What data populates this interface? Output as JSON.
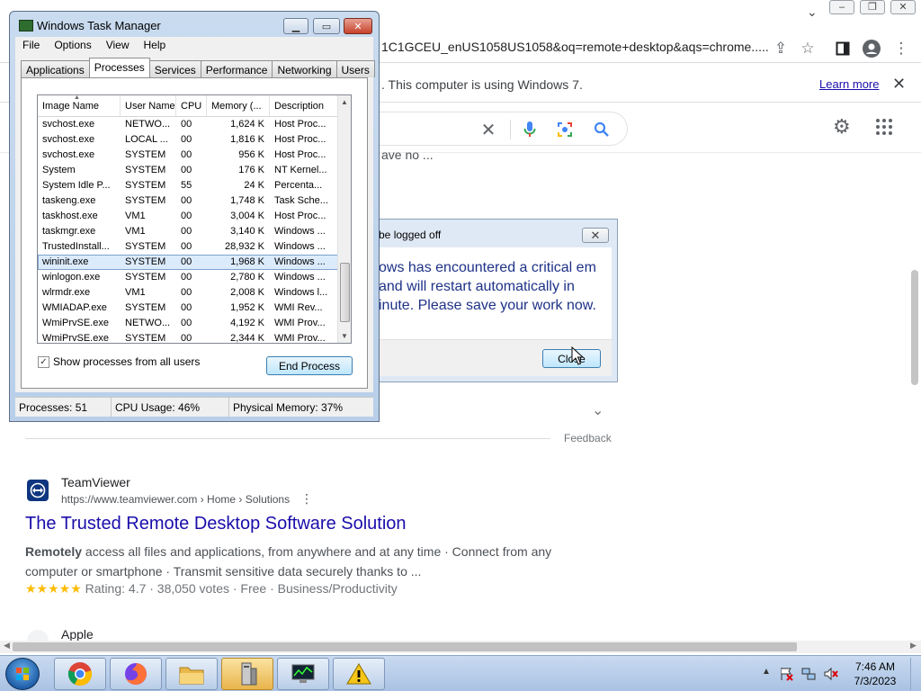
{
  "browser": {
    "url_visible": "1C1GCEU_enUS1058US1058&oq=remote+desktop&aqs=chrome.....",
    "infobar": {
      "text": ". This computer is using Windows 7.",
      "link": "Learn more"
    },
    "snippet_cut": "ave no ..."
  },
  "logoff_dialog": {
    "title": "t to be logged off",
    "message": "ows has encountered a critical em and will restart automatically in inute. Please save your work now.",
    "button": "Close"
  },
  "results": {
    "feedback": "Feedback",
    "teamviewer": {
      "site_name": "TeamViewer",
      "url": "https://www.teamviewer.com › Home › Solutions",
      "title": "The Trusted Remote Desktop Software Solution",
      "desc_bold": "Remotely",
      "desc_rest": " access all files and applications, from anywhere and at any time · Connect from any computer or smartphone · Transmit sensitive data securely thanks to ...",
      "stars": "★★★★★",
      "rating_text": "Rating: 4.7 · 38,050 votes · Free · Business/Productivity",
      "rating": 4.7
    },
    "next_site": "Apple"
  },
  "task_manager": {
    "title": "Windows Task Manager",
    "menus": [
      "File",
      "Options",
      "View",
      "Help"
    ],
    "tabs": [
      "Applications",
      "Processes",
      "Services",
      "Performance",
      "Networking",
      "Users"
    ],
    "active_tab": "Processes",
    "columns": [
      "Image Name",
      "User Name",
      "CPU",
      "Memory (...",
      "Description"
    ],
    "rows": [
      [
        "svchost.exe",
        "NETWO...",
        "00",
        "1,624 K",
        "Host Proc..."
      ],
      [
        "svchost.exe",
        "LOCAL ...",
        "00",
        "1,816 K",
        "Host Proc..."
      ],
      [
        "svchost.exe",
        "SYSTEM",
        "00",
        "956 K",
        "Host Proc..."
      ],
      [
        "System",
        "SYSTEM",
        "00",
        "176 K",
        "NT Kernel..."
      ],
      [
        "System Idle P...",
        "SYSTEM",
        "55",
        "24 K",
        "Percenta..."
      ],
      [
        "taskeng.exe",
        "SYSTEM",
        "00",
        "1,748 K",
        "Task Sche..."
      ],
      [
        "taskhost.exe",
        "VM1",
        "00",
        "3,004 K",
        "Host Proc..."
      ],
      [
        "taskmgr.exe",
        "VM1",
        "00",
        "3,140 K",
        "Windows ..."
      ],
      [
        "TrustedInstall...",
        "SYSTEM",
        "00",
        "28,932 K",
        "Windows ..."
      ],
      [
        "wininit.exe",
        "SYSTEM",
        "00",
        "1,968 K",
        "Windows ..."
      ],
      [
        "winlogon.exe",
        "SYSTEM",
        "00",
        "2,780 K",
        "Windows ..."
      ],
      [
        "wlrmdr.exe",
        "VM1",
        "00",
        "2,008 K",
        "Windows l..."
      ],
      [
        "WMIADAP.exe",
        "SYSTEM",
        "00",
        "1,952 K",
        "WMI Rev..."
      ],
      [
        "WmiPrvSE.exe",
        "NETWO...",
        "00",
        "4,192 K",
        "WMI Prov..."
      ],
      [
        "WmiPrvSE.exe",
        "SYSTEM",
        "00",
        "2,344 K",
        "WMI Prov..."
      ]
    ],
    "selected_row": 9,
    "show_all_label": "Show processes from all users",
    "show_all_checked": "✓",
    "end_process": "End Process",
    "status": {
      "processes": "Processes: 51",
      "cpu": "CPU Usage: 46%",
      "memory": "Physical Memory: 37%"
    }
  },
  "taskbar": {
    "time": "7:46 AM",
    "date": "7/3/2023"
  },
  "colors": {
    "link": "#1a0dab",
    "star": "#fbbc04",
    "dialog_text": "#1e3287"
  }
}
